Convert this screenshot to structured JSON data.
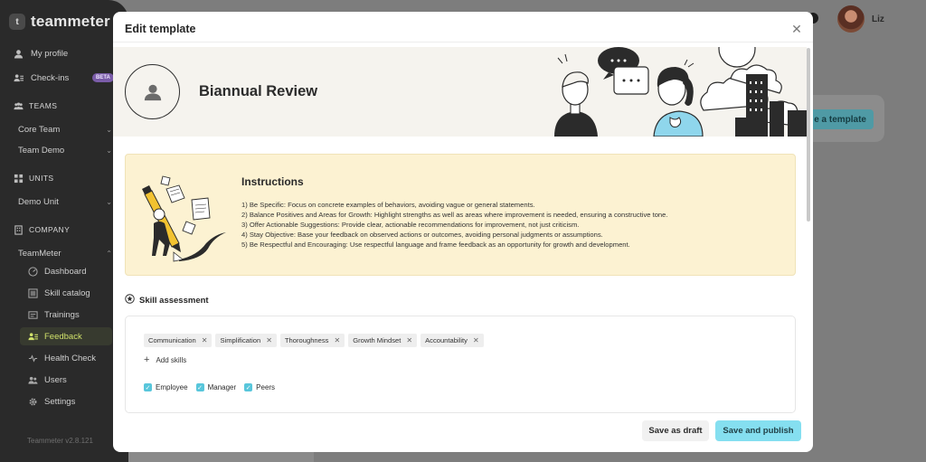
{
  "app": {
    "logo_text": "teammeter",
    "version": "Teammeter v2.8.121"
  },
  "sidebar": {
    "my_profile": "My profile",
    "check_ins": "Check-ins",
    "beta_badge": "BETA",
    "teams_section": "TEAMS",
    "core_team": "Core Team",
    "team_demo": "Team Demo",
    "units_section": "UNITS",
    "demo_unit": "Demo Unit",
    "company_section": "COMPANY",
    "teammeter_group": "TeamMeter",
    "items": [
      {
        "label": "Dashboard",
        "icon": "dashboard-icon",
        "active": false
      },
      {
        "label": "Skill catalog",
        "icon": "skill-catalog-icon",
        "active": false
      },
      {
        "label": "Trainings",
        "icon": "trainings-icon",
        "active": false
      },
      {
        "label": "Feedback",
        "icon": "feedback-icon",
        "active": true
      },
      {
        "label": "Health Check",
        "icon": "health-check-icon",
        "active": false
      },
      {
        "label": "Users",
        "icon": "users-icon",
        "active": false
      },
      {
        "label": "Settings",
        "icon": "gear-icon",
        "active": false
      }
    ]
  },
  "user": {
    "name": "Liz"
  },
  "background": {
    "button_label": "e a template"
  },
  "modal": {
    "title": "Edit template",
    "template_name": "Biannual Review",
    "instructions": {
      "title": "Instructions",
      "lines": [
        "1) Be Specific: Focus on concrete examples of behaviors, avoiding vague or general statements.",
        "2) Balance Positives and Areas for Growth: Highlight strengths as well as areas where improvement is needed, ensuring a constructive tone.",
        "3) Offer Actionable Suggestions: Provide clear, actionable recommendations for improvement, not just criticism.",
        "4) Stay Objective: Base your feedback on observed actions or outcomes, avoiding personal judgments or assumptions.",
        "5) Be Respectful and Encouraging: Use respectful language and frame feedback as an opportunity for growth and development."
      ]
    },
    "skill_assessment": {
      "title": "Skill assessment",
      "skills": [
        "Communication",
        "Simplification",
        "Thoroughness",
        "Growth Mindset",
        "Accountability"
      ],
      "add_skills_label": "Add skills",
      "reviewers": [
        {
          "label": "Employee",
          "checked": true
        },
        {
          "label": "Manager",
          "checked": true
        },
        {
          "label": "Peers",
          "checked": true
        }
      ]
    },
    "save_draft_label": "Save as draft",
    "save_publish_label": "Save and publish"
  },
  "colors": {
    "accent": "#85dff0",
    "active_nav": "#cfe06a",
    "instructions_bg": "#fcf2d2",
    "checkbox": "#58c6db"
  }
}
